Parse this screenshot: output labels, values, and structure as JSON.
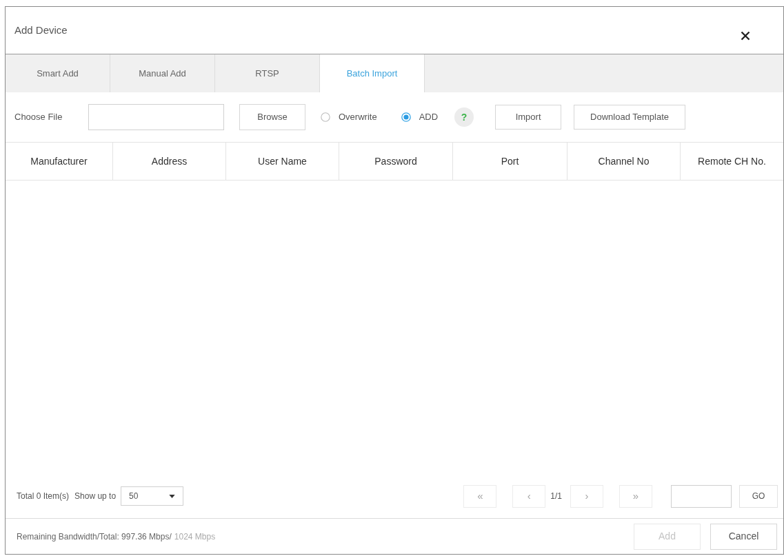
{
  "window": {
    "title": "Add Device"
  },
  "tabs": [
    {
      "label": "Smart Add",
      "selected": false
    },
    {
      "label": "Manual Add",
      "selected": false
    },
    {
      "label": "RTSP",
      "selected": false
    },
    {
      "label": "Batch Import",
      "selected": true
    }
  ],
  "toolbar": {
    "file_label": "Choose File",
    "browse_button": "Browse",
    "modes": [
      {
        "label": "Overwrite",
        "selected": false
      },
      {
        "label": "ADD",
        "selected": true
      }
    ],
    "help_button": "?",
    "import_button": "Import",
    "template_button": "Download Template"
  },
  "table": {
    "columns": [
      "Manufacturer",
      "Address",
      "User Name",
      "Password",
      "Port",
      "Channel No",
      "Remote CH No."
    ]
  },
  "pagination": {
    "total": "Total 0 Item(s)",
    "page_size_label": "Show up to",
    "page_size": "50",
    "nav_buttons": [
      {
        "label": "«",
        "disabled": true
      },
      {
        "label": "‹",
        "disabled": true
      },
      {
        "label": "›",
        "disabled": true
      },
      {
        "label": "»",
        "disabled": true
      }
    ],
    "page": "1/1",
    "go_button": "GO"
  },
  "footer": {
    "bandwidth": "Remaining Bandwidth/Total: 997.36 Mbps/",
    "bandwidth_total": "1024 Mbps",
    "buttons": [
      {
        "label": "Add",
        "disabled": true
      },
      {
        "label": "Cancel",
        "disabled": false
      }
    ]
  }
}
